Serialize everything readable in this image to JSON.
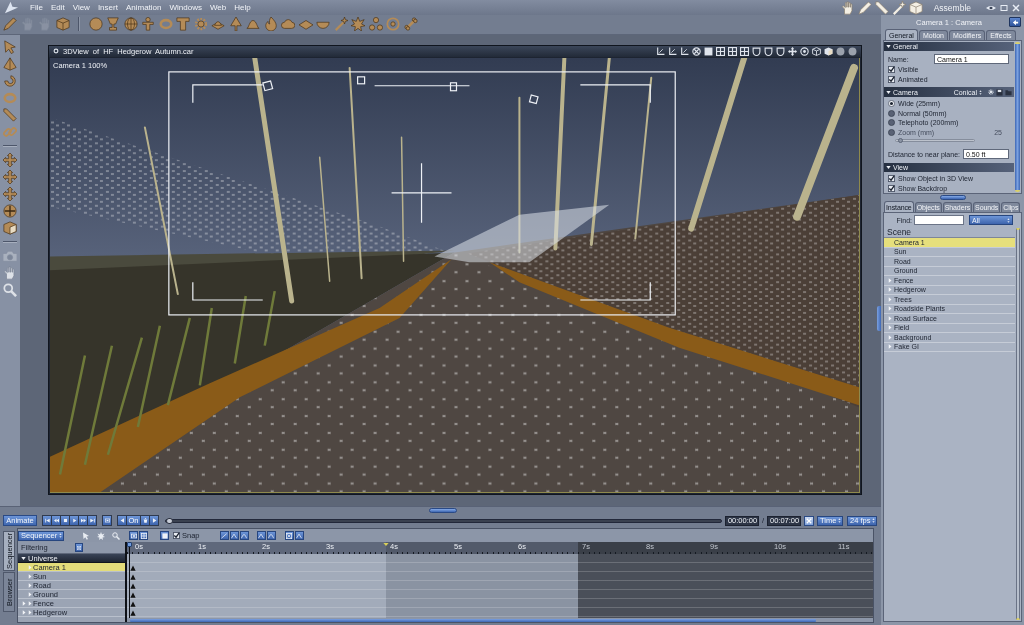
{
  "menu_bar": {
    "items": [
      "File",
      "Edit",
      "View",
      "Insert",
      "Animation",
      "Windows",
      "Web",
      "Help"
    ],
    "room": "Assemble"
  },
  "toolbar": {
    "tools": [
      {
        "disabled": false
      },
      {
        "disabled": true
      },
      {
        "disabled": true
      },
      {
        "disabled": false
      }
    ]
  },
  "side_toolbar": {
    "tools": [
      {
        "disabled": false
      },
      {
        "disabled": false
      },
      {
        "disabled": false
      },
      {
        "disabled": false
      },
      {
        "disabled": false
      },
      {
        "disabled": false
      },
      {
        "disabled": false
      },
      {
        "disabled": false
      },
      {
        "disabled": false
      },
      {
        "disabled": false
      },
      {
        "disabled": false
      },
      {
        "disabled": true
      },
      {
        "disabled": false
      },
      {
        "disabled": false
      }
    ]
  },
  "viewport": {
    "title": "3DView of HF Hedgerow Autumn.car",
    "camera_label": "Camera 1 100%"
  },
  "properties": {
    "title": "Camera 1 : Camera",
    "tabs": [
      {
        "label": "General",
        "selected": true
      },
      {
        "label": "Motion",
        "selected": false
      },
      {
        "label": "Modifiers",
        "selected": false
      },
      {
        "label": "Effects",
        "selected": false
      }
    ],
    "sections": [
      {
        "title": "General",
        "expanded": true,
        "rows": [
          {
            "kind": "field",
            "label": "Name:",
            "value": "Camera 1"
          },
          {
            "kind": "checkbox",
            "label": "Visible",
            "checked": true
          },
          {
            "kind": "checkbox",
            "label": "Animated",
            "checked": true
          }
        ]
      },
      {
        "title": "Camera",
        "expanded": true,
        "menu": "Conical",
        "rows": [
          {
            "kind": "radio",
            "label": "Wide (25mm)",
            "selected": true
          },
          {
            "kind": "radio",
            "label": "Normal (50mm)",
            "selected": false
          },
          {
            "kind": "radio",
            "label": "Telephoto (200mm)",
            "selected": false
          },
          {
            "kind": "slider",
            "label": "Zoom (mm)",
            "reading": "25",
            "selected": false,
            "disabled": true,
            "level": 0.03
          },
          {
            "kind": "field",
            "label": "Distance to near plane:",
            "value": "0.50 ft"
          }
        ]
      },
      {
        "title": "View",
        "expanded": true,
        "rows": [
          {
            "kind": "checkbox",
            "label": "Show Object in 3D View",
            "checked": true
          },
          {
            "kind": "checkbox",
            "label": "Show Backdrop",
            "checked": true
          }
        ]
      }
    ]
  },
  "browser": {
    "tabs": [
      {
        "label": "Instance",
        "selected": true
      },
      {
        "label": "Objects",
        "selected": false
      },
      {
        "label": "Shaders",
        "selected": false
      },
      {
        "label": "Sounds",
        "selected": false
      },
      {
        "label": "Clips",
        "selected": false
      }
    ],
    "find_label": "Find:",
    "filter": "All",
    "scene": {
      "label": "Scene",
      "children": [
        {
          "label": "Camera 1",
          "kind": "object",
          "selected": true
        },
        {
          "label": "Sun",
          "kind": "object",
          "selected": false
        },
        {
          "label": "Road",
          "kind": "object",
          "selected": false
        },
        {
          "label": "Ground",
          "kind": "object",
          "selected": false
        },
        {
          "label": "Fence",
          "kind": "group",
          "selected": false
        },
        {
          "label": "Hedgerow",
          "kind": "group",
          "selected": false
        },
        {
          "label": "Trees",
          "kind": "group",
          "selected": false
        },
        {
          "label": "Roadside Plants",
          "kind": "group",
          "selected": false
        },
        {
          "label": "Road Surface",
          "kind": "group",
          "selected": false
        },
        {
          "label": "Field",
          "kind": "group",
          "selected": false
        },
        {
          "label": "Background",
          "kind": "group",
          "selected": false
        },
        {
          "label": "Fake GI",
          "kind": "group",
          "selected": false
        }
      ]
    }
  },
  "timeline": {
    "animate": "Animate",
    "key_button": "On",
    "time_slider": {
      "level": 0
    },
    "current_time": "00:00:00",
    "separator": "/",
    "end_time": "00:07:00",
    "time_unit": "Time",
    "frame_rate": "24 fps",
    "side_tabs": [
      {
        "label": "Sequencer",
        "selected": true
      },
      {
        "label": "Browser",
        "selected": false
      }
    ],
    "mode": "Sequencer",
    "snap": {
      "label": "Snap",
      "checked": true
    },
    "filter_label": "Filtering",
    "tracks": {
      "label": "Universe",
      "expanded": true,
      "children": [
        {
          "label": "Camera 1",
          "kind": "object",
          "selected": true,
          "keyframe": true
        },
        {
          "label": "Sun",
          "kind": "object",
          "selected": false,
          "keyframe": true
        },
        {
          "label": "Road",
          "kind": "object",
          "selected": false,
          "keyframe": true
        },
        {
          "label": "Ground",
          "kind": "object",
          "selected": false,
          "keyframe": true
        },
        {
          "label": "Fence",
          "kind": "group",
          "selected": false,
          "keyframe": true
        },
        {
          "label": "Hedgerow",
          "kind": "group",
          "selected": false,
          "keyframe": true
        }
      ]
    },
    "ruler": [
      {
        "label": "0s",
        "kind": "preview"
      },
      {
        "label": "1s",
        "kind": "preview"
      },
      {
        "label": "2s",
        "kind": "preview"
      },
      {
        "label": "3s",
        "kind": "preview"
      },
      {
        "label": "4s",
        "kind": "duration"
      },
      {
        "label": "5s",
        "kind": "duration"
      },
      {
        "label": "6s",
        "kind": "duration"
      },
      {
        "label": "7s",
        "kind": "outside"
      },
      {
        "label": "8s",
        "kind": "outside"
      },
      {
        "label": "9s",
        "kind": "outside"
      },
      {
        "label": "10s",
        "kind": "outside"
      },
      {
        "label": "11s",
        "kind": "outside"
      }
    ]
  }
}
